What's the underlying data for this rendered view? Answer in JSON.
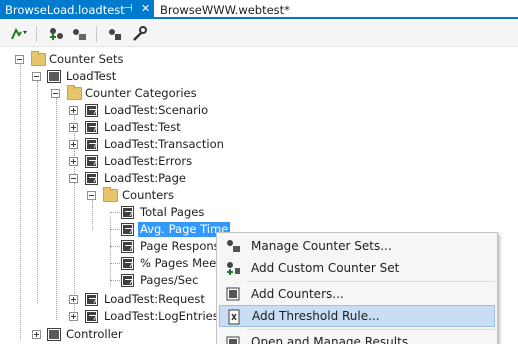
{
  "tabs": {
    "active": {
      "title": "BrowseLoad.loadtest",
      "pin_glyph": "⊣",
      "close_glyph": "✕"
    },
    "inactive": {
      "title": "BrowseWWW.webtest*"
    }
  },
  "toolbar": {
    "icons": [
      "run-test-icon",
      "add-counter-icon",
      "manage-icon",
      "settings-icon"
    ]
  },
  "tree": {
    "counter_sets": "Counter Sets",
    "load_test": "LoadTest",
    "counter_categories": "Counter Categories",
    "categories": [
      "LoadTest:Scenario",
      "LoadTest:Test",
      "LoadTest:Transaction",
      "LoadTest:Errors",
      "LoadTest:Page"
    ],
    "counters_folder": "Counters",
    "counters": [
      "Total Pages",
      "Avg. Page Time",
      "Page Respons",
      "% Pages Meeti",
      "Pages/Sec"
    ],
    "more_categories": [
      "LoadTest:Request",
      "LoadTest:LogEntries"
    ],
    "controller": "Controller"
  },
  "context_menu": {
    "items": [
      "Manage Counter Sets...",
      "Add Custom Counter Set",
      "Add Counters...",
      "Add Threshold Rule...",
      "Open and Manage Results..."
    ]
  }
}
